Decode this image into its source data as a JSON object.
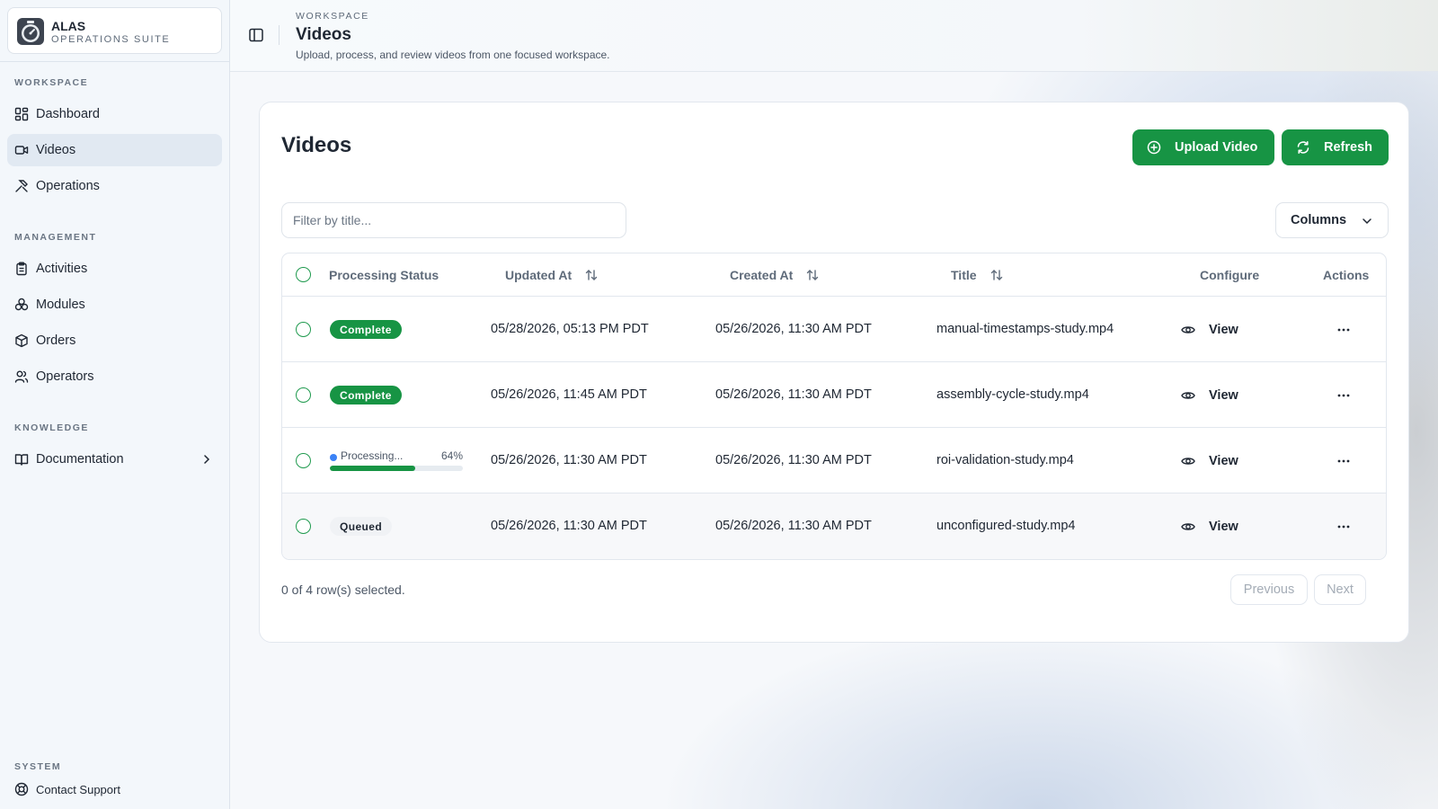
{
  "brand": {
    "name": "ALAS",
    "subtitle": "OPERATIONS SUITE"
  },
  "sidebar": {
    "sections": {
      "workspace": "WORKSPACE",
      "management": "MANAGEMENT",
      "knowledge": "KNOWLEDGE",
      "system": "SYSTEM"
    },
    "items": [
      {
        "label": "Dashboard",
        "icon": "dashboard-icon",
        "active": false
      },
      {
        "label": "Videos",
        "icon": "video-icon",
        "active": true
      },
      {
        "label": "Operations",
        "icon": "tools-icon",
        "active": false
      },
      {
        "label": "Activities",
        "icon": "clipboard-icon",
        "active": false
      },
      {
        "label": "Modules",
        "icon": "modules-icon",
        "active": false
      },
      {
        "label": "Orders",
        "icon": "package-icon",
        "active": false
      },
      {
        "label": "Operators",
        "icon": "users-icon",
        "active": false
      },
      {
        "label": "Documentation",
        "icon": "book-icon",
        "active": false
      },
      {
        "label": "Contact Support",
        "icon": "lifebuoy-icon",
        "active": false
      }
    ]
  },
  "header": {
    "eyebrow": "WORKSPACE",
    "title": "Videos",
    "description": "Upload, process, and review videos from one focused workspace."
  },
  "card": {
    "title": "Videos",
    "upload_label": "Upload Video",
    "refresh_label": "Refresh",
    "filter_placeholder": "Filter by title...",
    "filter_value": "",
    "columns_label": "Columns"
  },
  "table": {
    "headers": {
      "status": "Processing Status",
      "updated": "Updated At",
      "created": "Created At",
      "title": "Title",
      "configure": "Configure",
      "actions": "Actions"
    },
    "rows": [
      {
        "status": "Complete",
        "updated": "05/28/2026, 05:13 PM PDT",
        "created": "05/26/2026, 11:30 AM PDT",
        "title": "manual-timestamps-study.mp4",
        "configure": "View"
      },
      {
        "status": "Complete",
        "updated": "05/26/2026, 11:45 AM PDT",
        "created": "05/26/2026, 11:30 AM PDT",
        "title": "assembly-cycle-study.mp4",
        "configure": "View"
      },
      {
        "status": "Processing...",
        "progress_label": "64%",
        "progress": 0.64,
        "updated": "05/26/2026, 11:30 AM PDT",
        "created": "05/26/2026, 11:30 AM PDT",
        "title": "roi-validation-study.mp4",
        "configure": "View"
      },
      {
        "status": "Queued",
        "updated": "05/26/2026, 11:30 AM PDT",
        "created": "05/26/2026, 11:30 AM PDT",
        "title": "unconfigured-study.mp4",
        "configure": "View"
      }
    ]
  },
  "footer": {
    "selection": "0 of 4 row(s) selected.",
    "previous_label": "Previous",
    "next_label": "Next"
  },
  "colors": {
    "accent": "#179444",
    "processing_dot": "#3b82f6",
    "active_nav_bg": "#e1e9f2"
  }
}
